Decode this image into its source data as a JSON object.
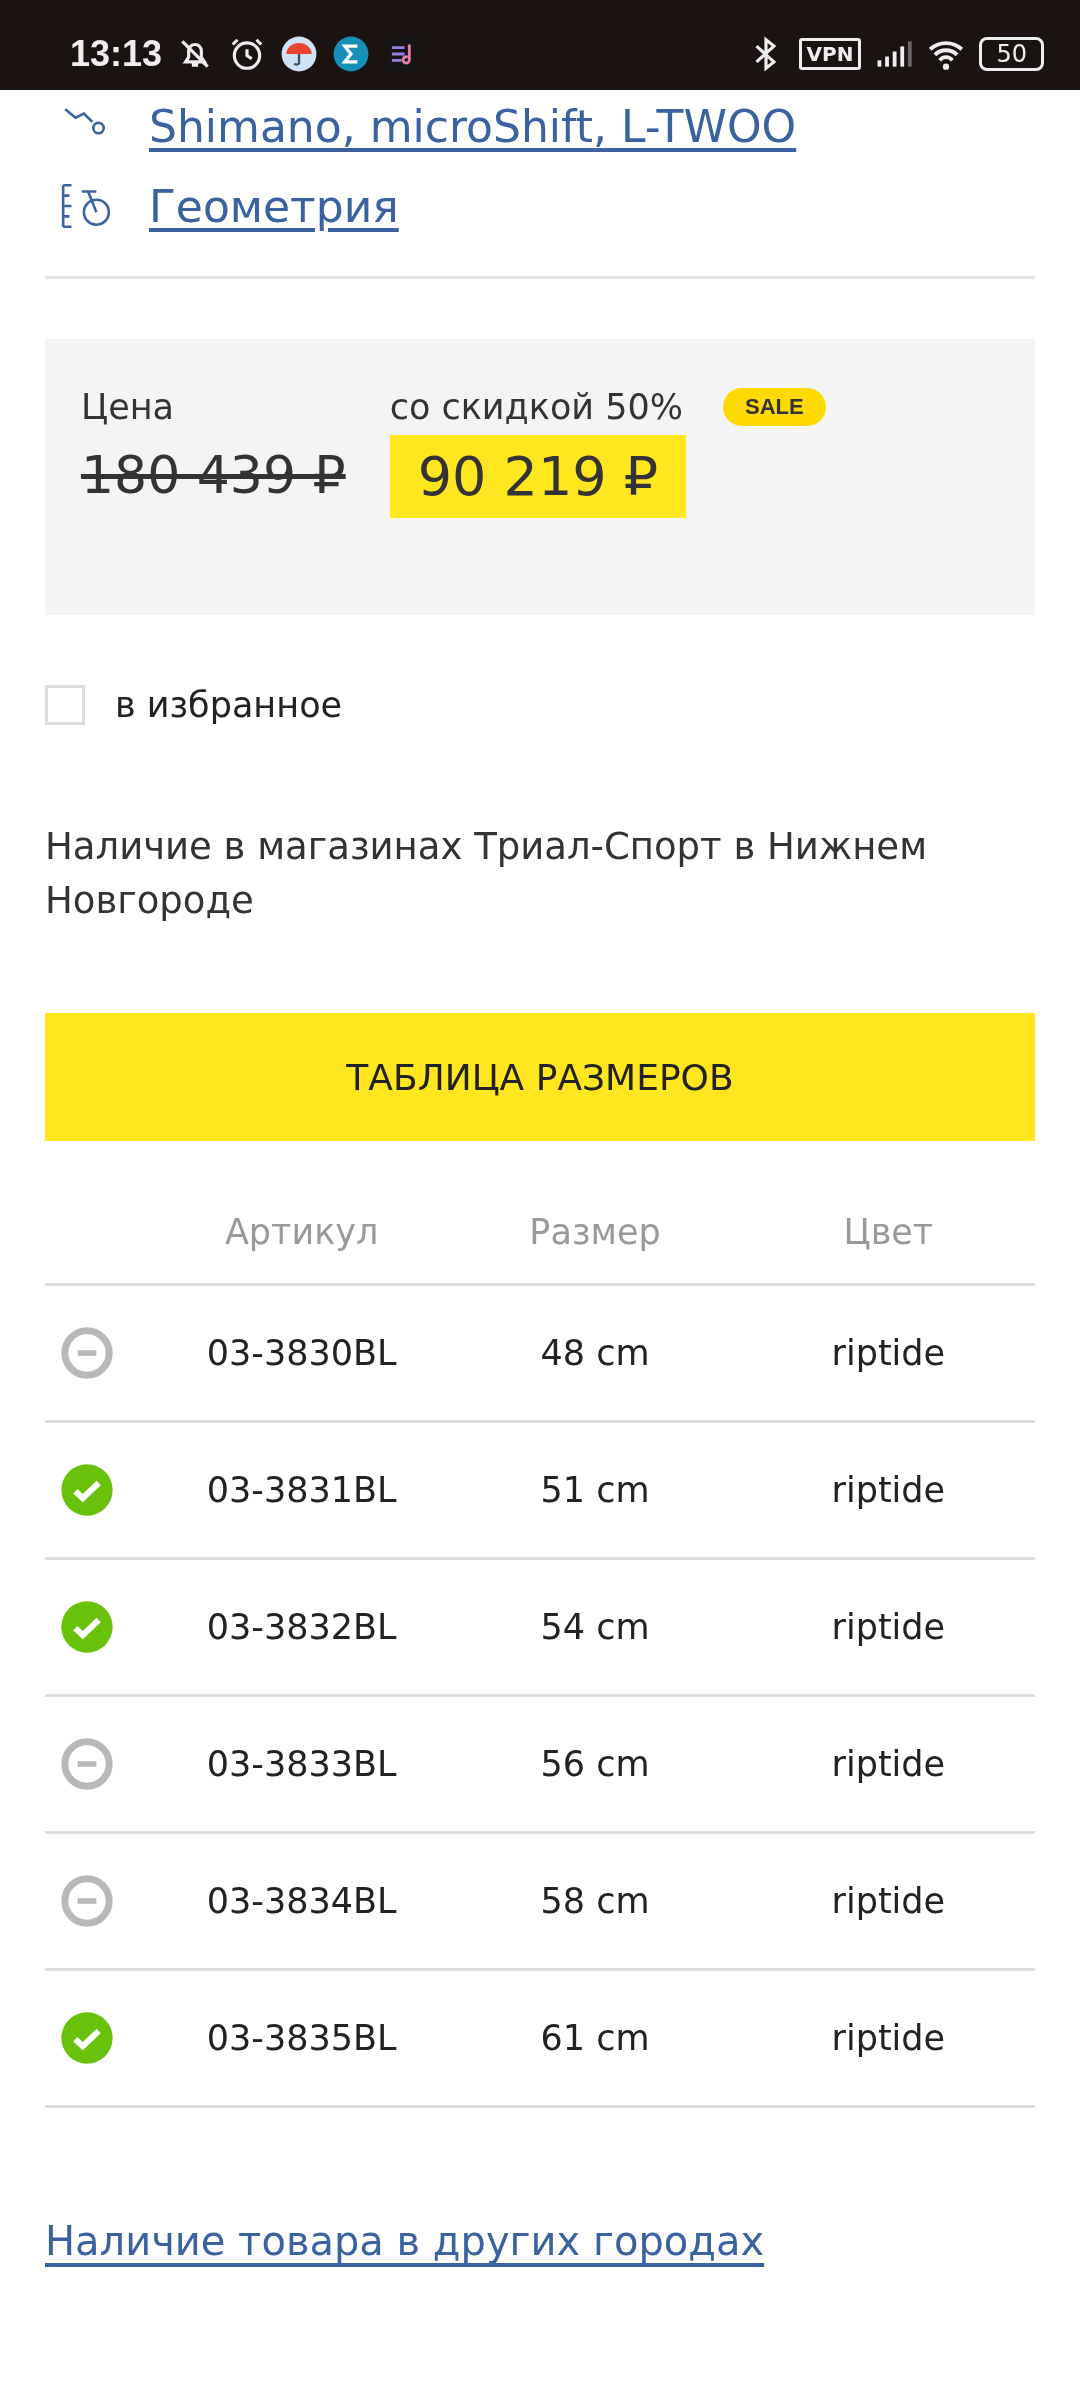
{
  "status_bar": {
    "time": "13:13",
    "vpn": "VPN",
    "battery": "50"
  },
  "links": [
    {
      "kind": "derailleur",
      "label": "Shimano, microShift, L-TWOO"
    },
    {
      "kind": "geometry",
      "label": "Геометрия"
    }
  ],
  "price": {
    "label": "Цена",
    "old_price": "180 439 ₽",
    "discount_label": "со скидкой 50%",
    "badge": "SALE",
    "new_price": "90 219 ₽"
  },
  "favorite": {
    "label": "в избранное",
    "checked": false
  },
  "availability_title": "Наличие в магазинах Триал-Спорт в Нижнем Новгороде",
  "size_table_button": "ТАБЛИЦА РАЗМЕРОВ",
  "table": {
    "columns": [
      "Артикул",
      "Размер",
      "Цвет"
    ],
    "rows": [
      {
        "available": false,
        "sku": "03-3830BL",
        "size": "48 cm",
        "color_name": "riptide"
      },
      {
        "available": true,
        "sku": "03-3831BL",
        "size": "51 cm",
        "color_name": "riptide"
      },
      {
        "available": true,
        "sku": "03-3832BL",
        "size": "54 cm",
        "color_name": "riptide"
      },
      {
        "available": false,
        "sku": "03-3833BL",
        "size": "56 cm",
        "color_name": "riptide"
      },
      {
        "available": false,
        "sku": "03-3834BL",
        "size": "58 cm",
        "color_name": "riptide"
      },
      {
        "available": true,
        "sku": "03-3835BL",
        "size": "61 cm",
        "color_name": "riptide"
      }
    ]
  },
  "other_cities_link": "Наличие товара в других городах"
}
